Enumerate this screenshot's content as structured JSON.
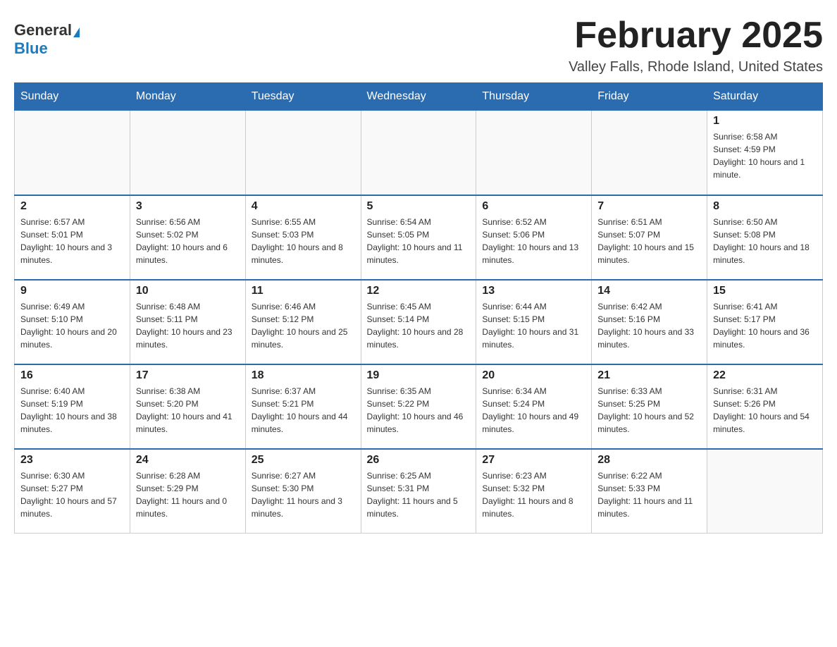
{
  "header": {
    "logo_general": "General",
    "logo_blue": "Blue",
    "month_title": "February 2025",
    "location": "Valley Falls, Rhode Island, United States"
  },
  "weekdays": [
    "Sunday",
    "Monday",
    "Tuesday",
    "Wednesday",
    "Thursday",
    "Friday",
    "Saturday"
  ],
  "weeks": [
    [
      {
        "day": "",
        "sunrise": "",
        "sunset": "",
        "daylight": ""
      },
      {
        "day": "",
        "sunrise": "",
        "sunset": "",
        "daylight": ""
      },
      {
        "day": "",
        "sunrise": "",
        "sunset": "",
        "daylight": ""
      },
      {
        "day": "",
        "sunrise": "",
        "sunset": "",
        "daylight": ""
      },
      {
        "day": "",
        "sunrise": "",
        "sunset": "",
        "daylight": ""
      },
      {
        "day": "",
        "sunrise": "",
        "sunset": "",
        "daylight": ""
      },
      {
        "day": "1",
        "sunrise": "Sunrise: 6:58 AM",
        "sunset": "Sunset: 4:59 PM",
        "daylight": "Daylight: 10 hours and 1 minute."
      }
    ],
    [
      {
        "day": "2",
        "sunrise": "Sunrise: 6:57 AM",
        "sunset": "Sunset: 5:01 PM",
        "daylight": "Daylight: 10 hours and 3 minutes."
      },
      {
        "day": "3",
        "sunrise": "Sunrise: 6:56 AM",
        "sunset": "Sunset: 5:02 PM",
        "daylight": "Daylight: 10 hours and 6 minutes."
      },
      {
        "day": "4",
        "sunrise": "Sunrise: 6:55 AM",
        "sunset": "Sunset: 5:03 PM",
        "daylight": "Daylight: 10 hours and 8 minutes."
      },
      {
        "day": "5",
        "sunrise": "Sunrise: 6:54 AM",
        "sunset": "Sunset: 5:05 PM",
        "daylight": "Daylight: 10 hours and 11 minutes."
      },
      {
        "day": "6",
        "sunrise": "Sunrise: 6:52 AM",
        "sunset": "Sunset: 5:06 PM",
        "daylight": "Daylight: 10 hours and 13 minutes."
      },
      {
        "day": "7",
        "sunrise": "Sunrise: 6:51 AM",
        "sunset": "Sunset: 5:07 PM",
        "daylight": "Daylight: 10 hours and 15 minutes."
      },
      {
        "day": "8",
        "sunrise": "Sunrise: 6:50 AM",
        "sunset": "Sunset: 5:08 PM",
        "daylight": "Daylight: 10 hours and 18 minutes."
      }
    ],
    [
      {
        "day": "9",
        "sunrise": "Sunrise: 6:49 AM",
        "sunset": "Sunset: 5:10 PM",
        "daylight": "Daylight: 10 hours and 20 minutes."
      },
      {
        "day": "10",
        "sunrise": "Sunrise: 6:48 AM",
        "sunset": "Sunset: 5:11 PM",
        "daylight": "Daylight: 10 hours and 23 minutes."
      },
      {
        "day": "11",
        "sunrise": "Sunrise: 6:46 AM",
        "sunset": "Sunset: 5:12 PM",
        "daylight": "Daylight: 10 hours and 25 minutes."
      },
      {
        "day": "12",
        "sunrise": "Sunrise: 6:45 AM",
        "sunset": "Sunset: 5:14 PM",
        "daylight": "Daylight: 10 hours and 28 minutes."
      },
      {
        "day": "13",
        "sunrise": "Sunrise: 6:44 AM",
        "sunset": "Sunset: 5:15 PM",
        "daylight": "Daylight: 10 hours and 31 minutes."
      },
      {
        "day": "14",
        "sunrise": "Sunrise: 6:42 AM",
        "sunset": "Sunset: 5:16 PM",
        "daylight": "Daylight: 10 hours and 33 minutes."
      },
      {
        "day": "15",
        "sunrise": "Sunrise: 6:41 AM",
        "sunset": "Sunset: 5:17 PM",
        "daylight": "Daylight: 10 hours and 36 minutes."
      }
    ],
    [
      {
        "day": "16",
        "sunrise": "Sunrise: 6:40 AM",
        "sunset": "Sunset: 5:19 PM",
        "daylight": "Daylight: 10 hours and 38 minutes."
      },
      {
        "day": "17",
        "sunrise": "Sunrise: 6:38 AM",
        "sunset": "Sunset: 5:20 PM",
        "daylight": "Daylight: 10 hours and 41 minutes."
      },
      {
        "day": "18",
        "sunrise": "Sunrise: 6:37 AM",
        "sunset": "Sunset: 5:21 PM",
        "daylight": "Daylight: 10 hours and 44 minutes."
      },
      {
        "day": "19",
        "sunrise": "Sunrise: 6:35 AM",
        "sunset": "Sunset: 5:22 PM",
        "daylight": "Daylight: 10 hours and 46 minutes."
      },
      {
        "day": "20",
        "sunrise": "Sunrise: 6:34 AM",
        "sunset": "Sunset: 5:24 PM",
        "daylight": "Daylight: 10 hours and 49 minutes."
      },
      {
        "day": "21",
        "sunrise": "Sunrise: 6:33 AM",
        "sunset": "Sunset: 5:25 PM",
        "daylight": "Daylight: 10 hours and 52 minutes."
      },
      {
        "day": "22",
        "sunrise": "Sunrise: 6:31 AM",
        "sunset": "Sunset: 5:26 PM",
        "daylight": "Daylight: 10 hours and 54 minutes."
      }
    ],
    [
      {
        "day": "23",
        "sunrise": "Sunrise: 6:30 AM",
        "sunset": "Sunset: 5:27 PM",
        "daylight": "Daylight: 10 hours and 57 minutes."
      },
      {
        "day": "24",
        "sunrise": "Sunrise: 6:28 AM",
        "sunset": "Sunset: 5:29 PM",
        "daylight": "Daylight: 11 hours and 0 minutes."
      },
      {
        "day": "25",
        "sunrise": "Sunrise: 6:27 AM",
        "sunset": "Sunset: 5:30 PM",
        "daylight": "Daylight: 11 hours and 3 minutes."
      },
      {
        "day": "26",
        "sunrise": "Sunrise: 6:25 AM",
        "sunset": "Sunset: 5:31 PM",
        "daylight": "Daylight: 11 hours and 5 minutes."
      },
      {
        "day": "27",
        "sunrise": "Sunrise: 6:23 AM",
        "sunset": "Sunset: 5:32 PM",
        "daylight": "Daylight: 11 hours and 8 minutes."
      },
      {
        "day": "28",
        "sunrise": "Sunrise: 6:22 AM",
        "sunset": "Sunset: 5:33 PM",
        "daylight": "Daylight: 11 hours and 11 minutes."
      },
      {
        "day": "",
        "sunrise": "",
        "sunset": "",
        "daylight": ""
      }
    ]
  ]
}
